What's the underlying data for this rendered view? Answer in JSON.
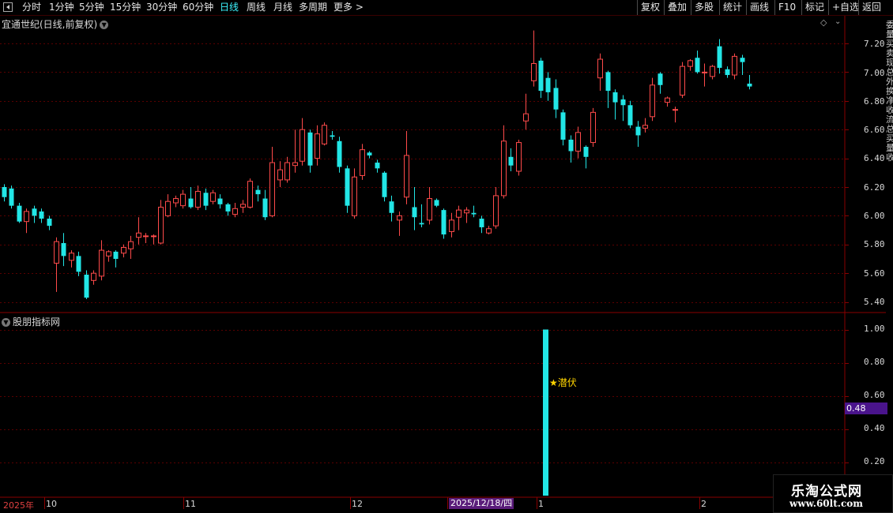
{
  "toolbar": {
    "periods": [
      "分时",
      "1分钟",
      "5分钟",
      "15分钟",
      "30分钟",
      "60分钟",
      "日线",
      "周线",
      "月线",
      "多周期",
      "更多"
    ],
    "active_period": "日线",
    "buttons": [
      "复权",
      "叠加",
      "多股",
      "统计",
      "画线",
      "F10",
      "标记",
      "+自选",
      "返回"
    ]
  },
  "main_panel": {
    "title": "宜通世纪(日线,前复权)"
  },
  "indicator_panel": {
    "title": "股朋指标网"
  },
  "signal": {
    "label": "★潜伏",
    "value": 1.0
  },
  "cursor": {
    "date": "2025/12/18/四",
    "value": "0.48"
  },
  "x_labels": [
    "2025年",
    "10",
    "11",
    "12",
    "1",
    "2"
  ],
  "side_text": [
    "委",
    "量",
    "买",
    "卖",
    "现",
    "总",
    "外",
    "换",
    "净",
    "收",
    "流",
    "总",
    "买",
    "量",
    "收"
  ],
  "watermark": {
    "title": "乐淘公式网",
    "url": "www.60lt.com"
  },
  "colors": {
    "up": "#ff4a4a",
    "down": "#22e6e6",
    "signal_bar": "#22e6e6",
    "grid": "#5a0000",
    "label": "#ffd400"
  },
  "chart_data": {
    "type": "candlestick",
    "price_ticks": [
      "7.20",
      "7.00",
      "6.80",
      "6.60",
      "6.40",
      "6.20",
      "6.00",
      "5.80",
      "5.60",
      "5.40"
    ],
    "ylim": [
      5.35,
      7.3
    ],
    "indicator_ticks": [
      "1.00",
      "0.80",
      "0.60",
      "0.40",
      "0.20"
    ],
    "indicator_ylim": [
      0,
      1.05
    ],
    "candles": [
      [
        6.2,
        6.13,
        6.22,
        6.1
      ],
      [
        6.19,
        6.07,
        6.21,
        6.05
      ],
      [
        6.07,
        5.96,
        6.09,
        5.95
      ],
      [
        5.96,
        6.03,
        6.05,
        5.88
      ],
      [
        6.05,
        6.0,
        6.07,
        5.95
      ],
      [
        6.03,
        5.98,
        6.05,
        5.95
      ],
      [
        5.98,
        5.93,
        6.0,
        5.9
      ],
      [
        5.67,
        5.82,
        5.85,
        5.47
      ],
      [
        5.81,
        5.72,
        5.88,
        5.65
      ],
      [
        5.69,
        5.74,
        5.76,
        5.64
      ],
      [
        5.72,
        5.61,
        5.75,
        5.58
      ],
      [
        5.59,
        5.43,
        5.62,
        5.42
      ],
      [
        5.55,
        5.6,
        5.62,
        5.52
      ],
      [
        5.58,
        5.76,
        5.83,
        5.55
      ],
      [
        5.72,
        5.75,
        5.76,
        5.68
      ],
      [
        5.75,
        5.7,
        5.76,
        5.64
      ],
      [
        5.74,
        5.78,
        5.8,
        5.71
      ],
      [
        5.77,
        5.82,
        5.86,
        5.7
      ],
      [
        5.85,
        5.88,
        5.99,
        5.8
      ],
      [
        5.86,
        5.86,
        5.88,
        5.81
      ],
      [
        5.86,
        5.86,
        5.87,
        5.8
      ],
      [
        5.81,
        6.06,
        6.11,
        5.8
      ],
      [
        6.0,
        6.1,
        6.15,
        5.99
      ],
      [
        6.09,
        6.12,
        6.14,
        6.06
      ],
      [
        6.07,
        6.15,
        6.18,
        6.05
      ],
      [
        6.12,
        6.06,
        6.2,
        6.05
      ],
      [
        6.06,
        6.17,
        6.21,
        6.04
      ],
      [
        6.16,
        6.07,
        6.19,
        6.04
      ],
      [
        6.1,
        6.16,
        6.18,
        6.08
      ],
      [
        6.12,
        6.08,
        6.15,
        6.05
      ],
      [
        6.08,
        6.03,
        6.09,
        6.0
      ],
      [
        6.01,
        6.05,
        6.09,
        5.99
      ],
      [
        6.06,
        6.08,
        6.11,
        6.02
      ],
      [
        6.06,
        6.24,
        6.26,
        6.05
      ],
      [
        6.18,
        6.15,
        6.21,
        6.1
      ],
      [
        6.12,
        5.99,
        6.18,
        5.97
      ],
      [
        6.0,
        6.37,
        6.48,
        5.99
      ],
      [
        6.25,
        6.32,
        6.38,
        6.2
      ],
      [
        6.25,
        6.37,
        6.41,
        6.23
      ],
      [
        6.35,
        6.37,
        6.6,
        6.3
      ],
      [
        6.38,
        6.6,
        6.68,
        6.35
      ],
      [
        6.58,
        6.35,
        6.6,
        6.3
      ],
      [
        6.4,
        6.57,
        6.63,
        6.35
      ],
      [
        6.5,
        6.63,
        6.65,
        6.49
      ],
      [
        6.56,
        6.55,
        6.59,
        6.53
      ],
      [
        6.52,
        6.34,
        6.55,
        6.3
      ],
      [
        6.33,
        6.07,
        6.35,
        6.02
      ],
      [
        6.0,
        6.27,
        6.33,
        5.98
      ],
      [
        6.28,
        6.46,
        6.5,
        6.25
      ],
      [
        6.44,
        6.42,
        6.45,
        6.4
      ],
      [
        6.37,
        6.33,
        6.39,
        6.3
      ],
      [
        6.3,
        6.13,
        6.31,
        6.1
      ],
      [
        6.1,
        6.02,
        6.14,
        5.96
      ],
      [
        5.97,
        6.0,
        6.03,
        5.86
      ],
      [
        6.13,
        6.42,
        6.59,
        6.08
      ],
      [
        6.06,
        5.99,
        6.2,
        5.9
      ],
      [
        5.95,
        5.94,
        6.08,
        5.92
      ],
      [
        5.97,
        6.12,
        6.2,
        5.94
      ],
      [
        6.11,
        6.07,
        6.12,
        6.06
      ],
      [
        6.04,
        5.87,
        6.05,
        5.84
      ],
      [
        5.89,
        5.97,
        6.02,
        5.85
      ],
      [
        5.99,
        6.04,
        6.07,
        5.9
      ],
      [
        6.02,
        6.04,
        6.06,
        5.95
      ],
      [
        6.02,
        6.01,
        6.07,
        5.99
      ],
      [
        5.98,
        5.92,
        6.0,
        5.88
      ],
      [
        5.88,
        5.91,
        5.93,
        5.87
      ],
      [
        5.93,
        6.14,
        6.2,
        5.91
      ],
      [
        6.14,
        6.52,
        6.63,
        6.12
      ],
      [
        6.41,
        6.35,
        6.47,
        6.31
      ],
      [
        6.31,
        6.51,
        6.53,
        6.28
      ],
      [
        6.66,
        6.71,
        6.85,
        6.6
      ],
      [
        6.94,
        7.06,
        7.29,
        6.9
      ],
      [
        7.08,
        6.87,
        7.1,
        6.82
      ],
      [
        6.96,
        6.86,
        7.0,
        6.8
      ],
      [
        6.89,
        6.74,
        6.95,
        6.68
      ],
      [
        6.72,
        6.53,
        6.74,
        6.49
      ],
      [
        6.53,
        6.45,
        6.56,
        6.37
      ],
      [
        6.45,
        6.58,
        6.62,
        6.4
      ],
      [
        6.48,
        6.41,
        6.49,
        6.33
      ],
      [
        6.51,
        6.72,
        6.75,
        6.48
      ],
      [
        6.96,
        7.09,
        7.13,
        6.87
      ],
      [
        7.0,
        6.87,
        7.01,
        6.75
      ],
      [
        6.86,
        6.79,
        6.88,
        6.67
      ],
      [
        6.81,
        6.77,
        6.84,
        6.66
      ],
      [
        6.77,
        6.63,
        6.8,
        6.61
      ],
      [
        6.62,
        6.56,
        6.66,
        6.48
      ],
      [
        6.61,
        6.63,
        6.68,
        6.58
      ],
      [
        6.69,
        6.91,
        6.96,
        6.66
      ],
      [
        6.99,
        6.91,
        7.0,
        6.85
      ],
      [
        6.79,
        6.82,
        6.83,
        6.76
      ],
      [
        6.74,
        6.74,
        6.76,
        6.65
      ],
      [
        6.84,
        7.04,
        7.07,
        6.82
      ],
      [
        7.04,
        7.08,
        7.09,
        7.01
      ],
      [
        7.1,
        7.0,
        7.15,
        6.99
      ],
      [
        7.0,
        7.0,
        7.06,
        6.9
      ],
      [
        6.97,
        7.04,
        7.05,
        6.95
      ],
      [
        7.18,
        7.03,
        7.23,
        6.99
      ],
      [
        7.02,
        6.98,
        7.04,
        6.96
      ],
      [
        6.98,
        7.11,
        7.13,
        6.95
      ],
      [
        7.1,
        7.07,
        7.12,
        6.98
      ],
      [
        6.92,
        6.9,
        6.98,
        6.88
      ]
    ]
  }
}
